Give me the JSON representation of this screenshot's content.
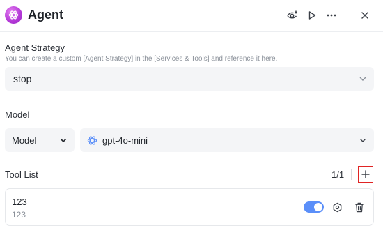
{
  "header": {
    "title": "Agent",
    "icons": [
      "agent-app-icon",
      "eye-plus-icon",
      "play-icon",
      "more-icon",
      "close-icon"
    ]
  },
  "strategy": {
    "label": "Agent Strategy",
    "hint": "You can create a custom [Agent Strategy] in the [Services & Tools] and reference it here.",
    "value": "stop"
  },
  "model": {
    "label": "Model",
    "type_value": "Model",
    "model_value": "gpt-4o-mini"
  },
  "tools": {
    "label": "Tool List",
    "count": "1/1",
    "items": [
      {
        "name": "123",
        "description": "123",
        "enabled": true
      }
    ]
  },
  "colors": {
    "accent": "#5b8ff9",
    "brand": "#b237d6",
    "add_outline": "#e02424"
  }
}
